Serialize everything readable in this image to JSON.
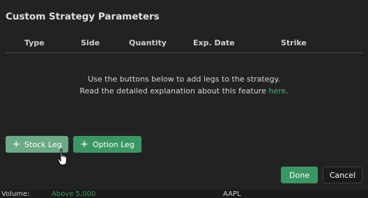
{
  "modal": {
    "title": "Custom Strategy Parameters",
    "columns": [
      "Type",
      "Side",
      "Quantity",
      "Exp. Date",
      "Strike"
    ],
    "empty_line1": "Use the buttons below to add legs to the strategy.",
    "empty_line2_prefix": "Read the detailed explanation about this feature ",
    "empty_line2_link": "here",
    "empty_line2_suffix": ".",
    "add_stock_leg": "Stock Leg",
    "add_option_leg": "Option Leg",
    "plus_symbol": "+",
    "done": "Done",
    "cancel": "Cancel"
  },
  "background": {
    "label": "Volume:",
    "value": "Above 5,000",
    "ticker": "AAPL"
  },
  "colors": {
    "accent_green": "#3a9765",
    "hover_green": "#6aaa86",
    "link_green": "#4caf7a"
  },
  "icons": {
    "cursor": "hand-pointer-icon"
  }
}
